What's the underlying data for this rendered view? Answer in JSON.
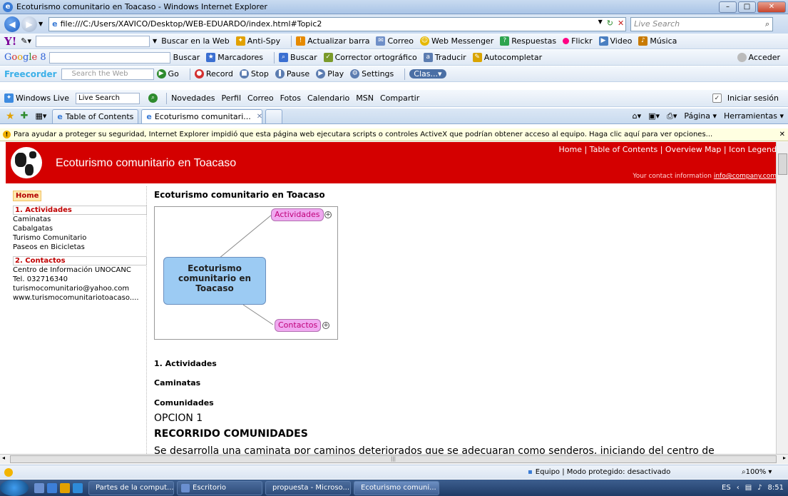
{
  "window": {
    "title": "Ecoturismo comunitario en Toacaso - Windows Internet Explorer"
  },
  "address": {
    "url": "file:///C:/Users/XAVICO/Desktop/WEB-EDUARDO/index.html#Topic2",
    "search_placeholder": "Live Search"
  },
  "yahoo_toolbar": {
    "logo": "Y!",
    "search_btn": "Buscar en la Web",
    "antispy": "Anti-Spy",
    "update": "Actualizar barra",
    "mail": "Correo",
    "messenger": "Web Messenger",
    "answers": "Respuestas",
    "flickr": "Flickr",
    "video": "Video",
    "music": "Música"
  },
  "google_toolbar": {
    "logo_parts": [
      "G",
      "o",
      "o",
      "g",
      "l",
      "e"
    ],
    "suffix": "8",
    "search_btn": "Buscar",
    "bookmarks": "Marcadores",
    "search2": "Buscar",
    "spell": "Corrector ortográfico",
    "translate": "Traducir",
    "autocomplete": "Autocompletar",
    "signin": "Acceder"
  },
  "freecorder_toolbar": {
    "logo": "Freecorder",
    "search_placeholder": "Search the Web",
    "go": "Go",
    "record": "Record",
    "stop": "Stop",
    "pause": "Pause",
    "play": "Play",
    "settings": "Settings",
    "clas": "Clas..."
  },
  "live_toolbar": {
    "label": "Windows Live",
    "search_value": "Live Search",
    "links": [
      "Novedades",
      "Perfil",
      "Correo",
      "Fotos",
      "Calendario",
      "MSN",
      "Compartir"
    ],
    "signin": "Iniciar sesión"
  },
  "tabs": {
    "items": [
      "Table of Contents",
      "Ecoturismo comunitari..."
    ],
    "page_menu": "Página",
    "tools_menu": "Herramientas"
  },
  "infobar": {
    "text": "Para ayudar a proteger su seguridad, Internet Explorer impidió que esta página web ejecutara scripts o controles ActiveX que podrían obtener acceso al equipo. Haga clic aquí para ver opciones..."
  },
  "site": {
    "title": "Ecoturismo comunitario en Toacaso",
    "toplinks": "Home | Table of Contents | Overview Map | Icon Legend",
    "contact_label": "Your contact information",
    "contact_email": "info@company.com"
  },
  "sidebar": {
    "home": "Home",
    "section1": "1. Actividades",
    "section1_items": [
      "Caminatas",
      "Cabalgatas",
      "Turismo Comunitario",
      "Paseos en Bicicletas"
    ],
    "section2": "2. Contactos",
    "section2_items": [
      "Centro de Información UNOCANC",
      "Tel. 032716340",
      "turismocomunitario@yahoo.com",
      "www.turismocomunitariotoacaso...."
    ]
  },
  "content": {
    "heading": "Ecoturismo comunitario en Toacaso",
    "map_central": "Ecoturismo comunitario en Toacaso",
    "map_child1": "Actividades",
    "map_child2": "Contactos",
    "section_actividades": "1. Actividades",
    "caminatas": "Caminatas",
    "comunidades": "Comunidades",
    "opcion": "OPCION 1",
    "recorrido": "RECORRIDO COMUNIDADES",
    "paragraph": "Se desarrolla una caminata por caminos deteriorados que se adecuaran como senderos, iniciando del centro de"
  },
  "status": {
    "mode": "Equipo | Modo protegido: desactivado",
    "zoom": "100%"
  },
  "taskbar": {
    "tasks": [
      "Partes de la comput...",
      "Escritorio",
      "propuesta - Microso...",
      "Ecoturismo comuni..."
    ],
    "lang": "ES",
    "time": "8:51"
  },
  "colors": {
    "header_red": "#d40000",
    "section_red": "#c00000",
    "map_central_fill": "#9ccbf3",
    "map_child_fill": "#f0a8f0"
  }
}
